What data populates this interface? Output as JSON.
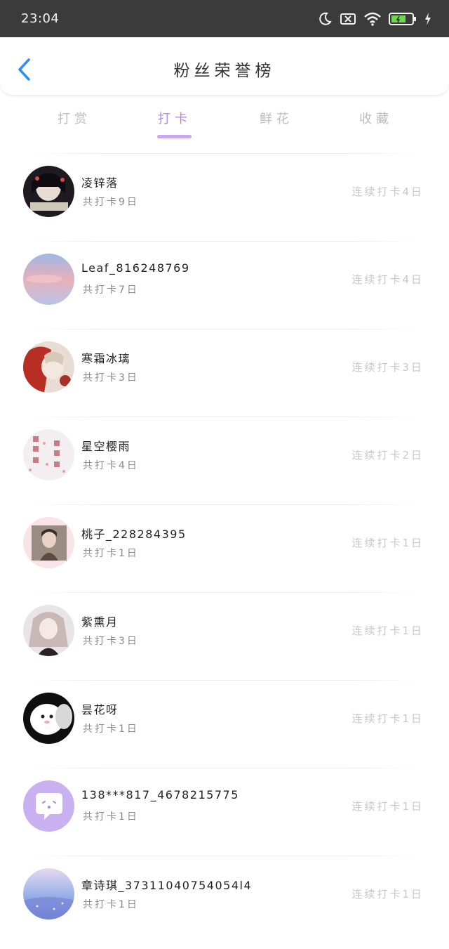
{
  "status_bar": {
    "time": "23:04"
  },
  "header": {
    "title": "粉丝荣誉榜"
  },
  "tabs": [
    {
      "label": "打赏"
    },
    {
      "label": "打卡"
    },
    {
      "label": "鲜花"
    },
    {
      "label": "收藏"
    }
  ],
  "active_tab": "打卡",
  "colors": {
    "accent": "#b48ae0",
    "back_icon": "#2f8ef5",
    "status_bar_bg": "#3b3b3b"
  },
  "fans": [
    {
      "name": "凌锌落",
      "total": "共打卡9日",
      "streak": "连续打卡4日"
    },
    {
      "name": "Leaf_816248769",
      "total": "共打卡7日",
      "streak": "连续打卡4日"
    },
    {
      "name": "寒霜冰璃",
      "total": "共打卡3日",
      "streak": "连续打卡3日"
    },
    {
      "name": "星空樱雨",
      "total": "共打卡4日",
      "streak": "连续打卡2日"
    },
    {
      "name": "桃子_228284395",
      "total": "共打卡1日",
      "streak": "连续打卡1日"
    },
    {
      "name": "紫熏月",
      "total": "共打卡3日",
      "streak": "连续打卡1日"
    },
    {
      "name": "昙花呀",
      "total": "共打卡1日",
      "streak": "连续打卡1日"
    },
    {
      "name": "138***817_4678215775",
      "total": "共打卡1日",
      "streak": "连续打卡1日"
    },
    {
      "name": "章诗琪_37311040754054l4",
      "total": "共打卡1日",
      "streak": "连续打卡1日"
    }
  ]
}
